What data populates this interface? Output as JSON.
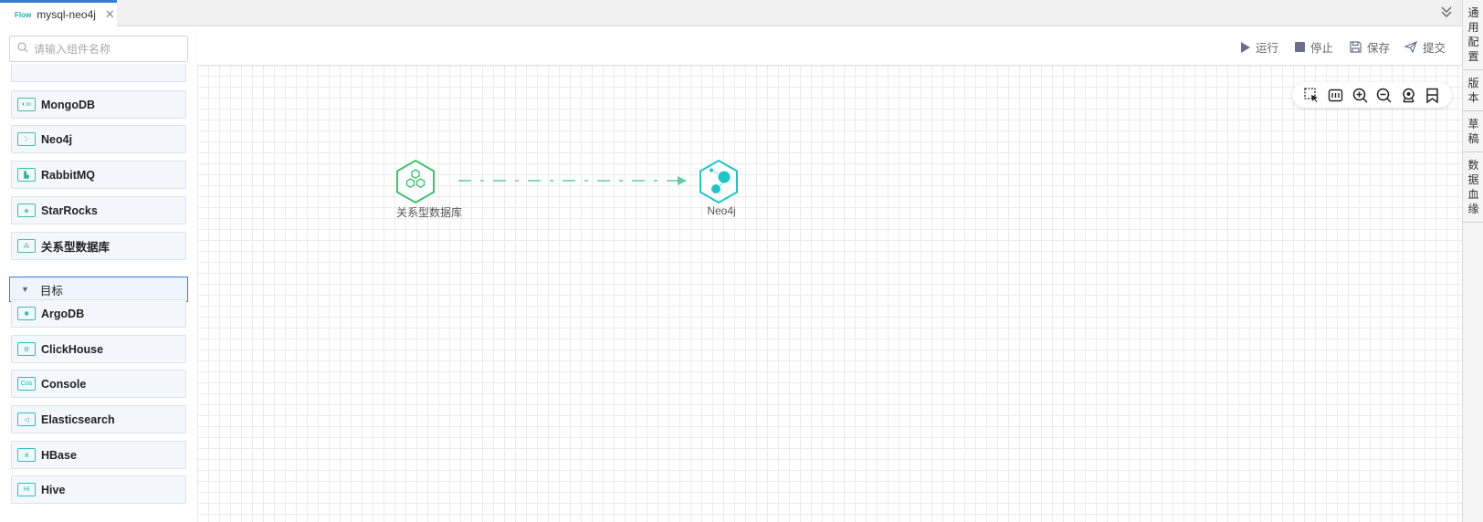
{
  "tab": {
    "icon_text": "Flow",
    "title": "mysql-neo4j"
  },
  "right_panel": [
    {
      "label": "通用配置",
      "chars": [
        "通",
        "用",
        "配",
        "置"
      ]
    },
    {
      "label": "版本",
      "chars": [
        "版",
        "本"
      ]
    },
    {
      "label": "草稿",
      "chars": [
        "草",
        "稿"
      ]
    },
    {
      "label": "数据血缘",
      "chars": [
        "数",
        "据",
        "血",
        "缘"
      ]
    }
  ],
  "search": {
    "placeholder": "请输入组件名称"
  },
  "sources": [
    {
      "label": "MongoDB",
      "icon": "mongodb-icon"
    },
    {
      "label": "Neo4j",
      "icon": "neo4j-icon"
    },
    {
      "label": "RabbitMQ",
      "icon": "rabbitmq-icon"
    },
    {
      "label": "StarRocks",
      "icon": "starrocks-icon"
    },
    {
      "label": "关系型数据库",
      "icon": "relational-db-icon"
    }
  ],
  "target_group": {
    "label": "目标"
  },
  "targets": [
    {
      "label": "ArgoDB",
      "icon": "argodb-icon"
    },
    {
      "label": "ClickHouse",
      "icon": "clickhouse-icon"
    },
    {
      "label": "Console",
      "icon": "console-icon",
      "icon_text": "Cos"
    },
    {
      "label": "Elasticsearch",
      "icon": "elasticsearch-icon"
    },
    {
      "label": "HBase",
      "icon": "hbase-icon"
    },
    {
      "label": "Hive",
      "icon": "hive-icon",
      "icon_text": "Hi"
    }
  ],
  "toolbar": {
    "run": "运行",
    "stop": "停止",
    "save": "保存",
    "submit": "提交"
  },
  "canvas": {
    "nodes": [
      {
        "label": "关系型数据库",
        "color": "#3ec46d"
      },
      {
        "label": "Neo4j",
        "color": "#1fc6c8"
      }
    ],
    "edge_color": "#5fcf9c"
  },
  "colors": {
    "accent": "#3a7bd5",
    "source": "#3ec46d",
    "target": "#1fc6c8"
  }
}
